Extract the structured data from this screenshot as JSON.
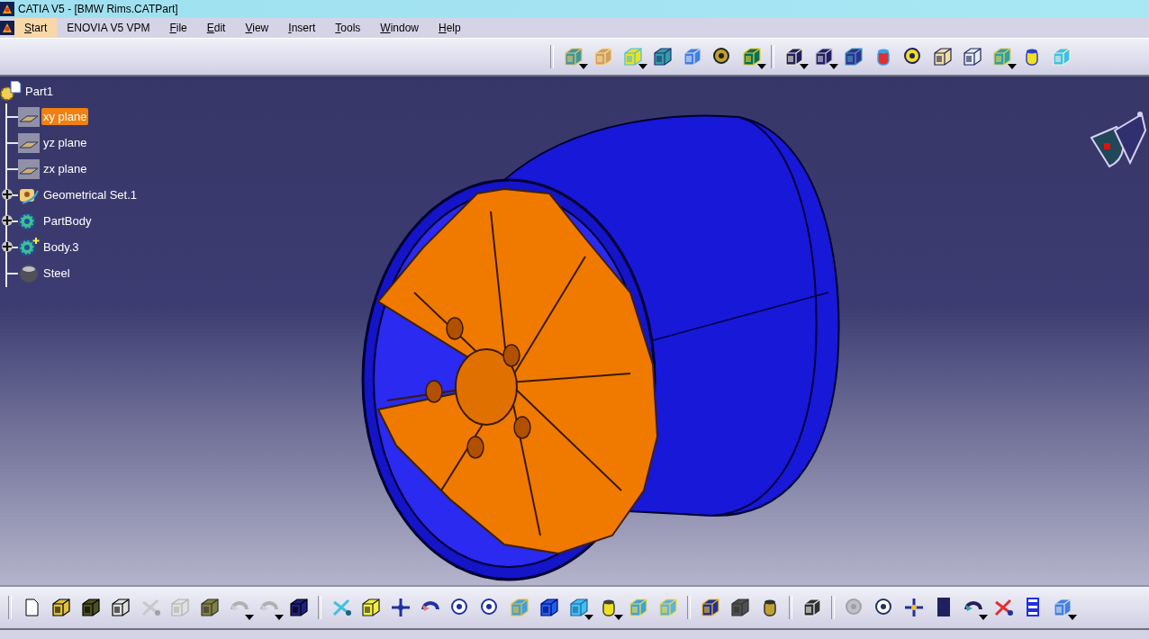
{
  "window": {
    "title": "CATIA V5 - [BMW Rims.CATPart]"
  },
  "menu": [
    {
      "label": "Start",
      "selected": true,
      "underline_first": true
    },
    {
      "label": "ENOVIA V5 VPM",
      "selected": false,
      "underline_first": false
    },
    {
      "label": "File",
      "selected": false,
      "underline_first": true
    },
    {
      "label": "Edit",
      "selected": false,
      "underline_first": true
    },
    {
      "label": "View",
      "selected": false,
      "underline_first": true
    },
    {
      "label": "Insert",
      "selected": false,
      "underline_first": true
    },
    {
      "label": "Tools",
      "selected": false,
      "underline_first": true
    },
    {
      "label": "Window",
      "selected": false,
      "underline_first": true
    },
    {
      "label": "Help",
      "selected": false,
      "underline_first": true
    }
  ],
  "tree": {
    "label": "Part1",
    "kind": "part",
    "children": [
      {
        "label": "xy plane",
        "kind": "plane",
        "selected": true
      },
      {
        "label": "yz plane",
        "kind": "plane",
        "selected": false
      },
      {
        "label": "zx plane",
        "kind": "plane",
        "selected": false
      },
      {
        "label": "Geometrical Set.1",
        "kind": "set",
        "selected": false,
        "expanded": false
      },
      {
        "label": "PartBody",
        "kind": "body",
        "selected": false,
        "expanded": false
      },
      {
        "label": "Body.3",
        "kind": "body-new",
        "selected": false,
        "expanded": false
      },
      {
        "label": "Steel",
        "kind": "material",
        "selected": false
      }
    ]
  }
}
